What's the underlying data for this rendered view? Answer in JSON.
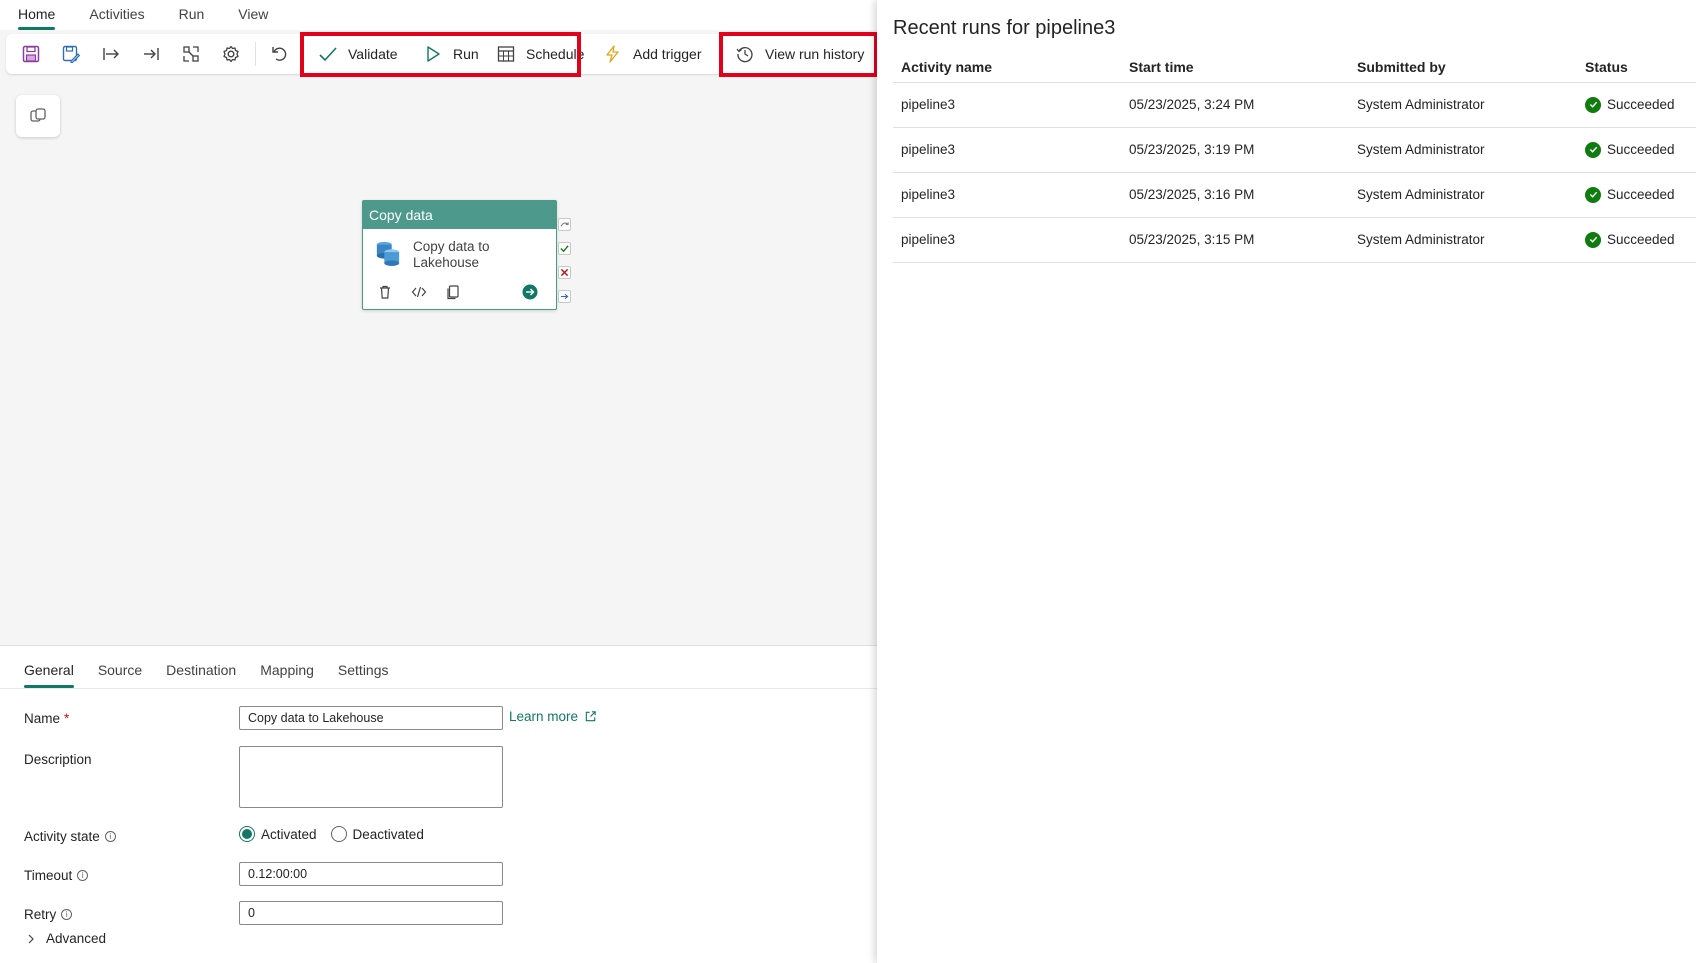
{
  "menu": {
    "tabs": [
      "Home",
      "Activities",
      "Run",
      "View"
    ],
    "active": "Home"
  },
  "toolbar": {
    "validate_label": "Validate",
    "run_label": "Run",
    "schedule_label": "Schedule",
    "add_trigger_label": "Add trigger",
    "view_run_history_label": "View run history",
    "icons": [
      "save-icon",
      "save-as-icon",
      "move-in-icon",
      "move-to-end-icon",
      "auto-layout-icon",
      "settings-icon",
      "undo-icon"
    ]
  },
  "canvas": {
    "activity": {
      "type_label": "Copy data",
      "name": "Copy data to Lakehouse",
      "name_line1": "Copy data to",
      "name_line2": "Lakehouse"
    }
  },
  "properties": {
    "tabs": [
      "General",
      "Source",
      "Destination",
      "Mapping",
      "Settings"
    ],
    "active_tab": "General",
    "name_label": "Name",
    "name_required_mark": "*",
    "name_value": "Copy data to Lakehouse",
    "learn_more_label": "Learn more",
    "description_label": "Description",
    "description_value": "",
    "activity_state_label": "Activity state",
    "state_activated": "Activated",
    "state_deactivated": "Deactivated",
    "state_selected": "Activated",
    "timeout_label": "Timeout",
    "timeout_value": "0.12:00:00",
    "retry_label": "Retry",
    "retry_value": "0",
    "advanced_label": "Advanced"
  },
  "runs_panel": {
    "title": "Recent runs for pipeline3",
    "columns": [
      "Activity name",
      "Start time",
      "Submitted by",
      "Status"
    ],
    "rows": [
      {
        "activity": "pipeline3",
        "start": "05/23/2025, 3:24 PM",
        "submitted_by": "System Administrator",
        "status": "Succeeded"
      },
      {
        "activity": "pipeline3",
        "start": "05/23/2025, 3:19 PM",
        "submitted_by": "System Administrator",
        "status": "Succeeded"
      },
      {
        "activity": "pipeline3",
        "start": "05/23/2025, 3:16 PM",
        "submitted_by": "System Administrator",
        "status": "Succeeded"
      },
      {
        "activity": "pipeline3",
        "start": "05/23/2025, 3:15 PM",
        "submitted_by": "System Administrator",
        "status": "Succeeded"
      }
    ]
  },
  "colors": {
    "accent": "#117865",
    "highlight": "#e3001b",
    "success": "#107c10",
    "activity_header": "#4d9a8c"
  }
}
